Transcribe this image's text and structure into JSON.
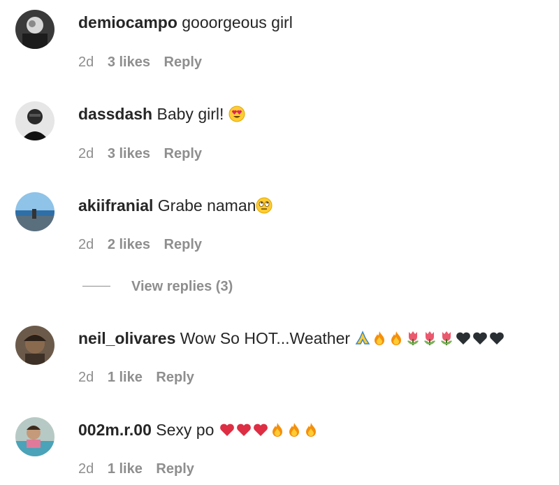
{
  "comments": [
    {
      "username": "demiocampo",
      "text": " gooorgeous girl",
      "emojis": [],
      "time": "2d",
      "likes": "3 likes",
      "reply": "Reply"
    },
    {
      "username": "dassdash",
      "text": " Baby girl! ",
      "emojis": [
        "heart-eyes-emoji"
      ],
      "time": "2d",
      "likes": "3 likes",
      "reply": "Reply"
    },
    {
      "username": "akiifranial",
      "text": " Grabe naman",
      "emojis": [
        "eye-roll-emoji"
      ],
      "time": "2d",
      "likes": "2 likes",
      "reply": "Reply"
    },
    {
      "username": "neil_olivares",
      "text": " Wow So HOT...Weather ",
      "emojis": [
        "folded-hands-emoji",
        "fire-emoji",
        "fire-emoji",
        "tulip-emoji",
        "tulip-emoji",
        "tulip-emoji",
        "black-heart-emoji",
        "black-heart-emoji",
        "black-heart-emoji"
      ],
      "time": "2d",
      "likes": "1 like",
      "reply": "Reply"
    },
    {
      "username": "002m.r.00",
      "text": " Sexy po ",
      "emojis": [
        "red-heart-emoji",
        "red-heart-emoji",
        "red-heart-emoji",
        "fire-emoji",
        "fire-emoji",
        "fire-emoji"
      ],
      "time": "2d",
      "likes": "1 like",
      "reply": "Reply"
    }
  ],
  "view_replies": "View replies (3)",
  "colors": {
    "text": "#262626",
    "muted": "#8e8e8e"
  }
}
